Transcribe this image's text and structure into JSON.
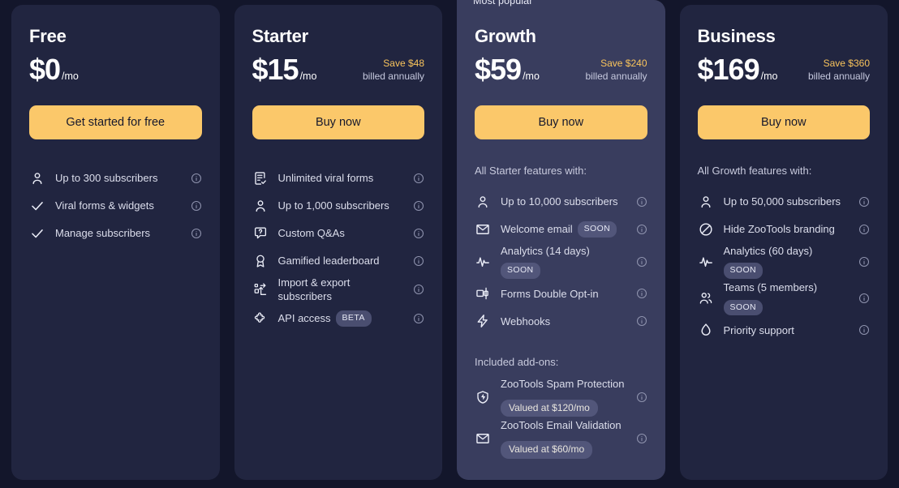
{
  "theme": {
    "page_bg": "#13162b",
    "card_bg": "#212540",
    "popular_card_bg": "#393d5e",
    "accent": "#fbc86a",
    "save_text": "#f9c45c"
  },
  "plans": [
    {
      "name": "Free",
      "price": "$0",
      "period": "/mo",
      "save_amount": "",
      "save_billed": "",
      "cta": "Get started for free",
      "features_intro": "",
      "features": [
        {
          "icon": "person-icon",
          "label": "Up to 300 subscribers",
          "tag": ""
        },
        {
          "icon": "check-icon",
          "label": "Viral forms & widgets",
          "tag": ""
        },
        {
          "icon": "check-icon",
          "label": "Manage subscribers",
          "tag": ""
        }
      ],
      "addons_intro": "",
      "addons": []
    },
    {
      "name": "Starter",
      "price": "$15",
      "period": "/mo",
      "save_amount": "Save $48",
      "save_billed": "billed annually",
      "cta": "Buy now",
      "features_intro": "",
      "features": [
        {
          "icon": "form-check-icon",
          "label": "Unlimited viral forms",
          "tag": ""
        },
        {
          "icon": "person-icon",
          "label": "Up to 1,000 subscribers",
          "tag": ""
        },
        {
          "icon": "question-bubble-icon",
          "label": "Custom Q&As",
          "tag": ""
        },
        {
          "icon": "award-ribbon-icon",
          "label": "Gamified leaderboard",
          "tag": ""
        },
        {
          "icon": "import-export-icon",
          "label": "Import & export subscribers",
          "tag": ""
        },
        {
          "icon": "puzzle-icon",
          "label": "API access",
          "tag": "BETA"
        }
      ],
      "addons_intro": "",
      "addons": []
    },
    {
      "name": "Growth",
      "badge": "Most popular",
      "price": "$59",
      "period": "/mo",
      "save_amount": "Save $240",
      "save_billed": "billed annually",
      "cta": "Buy now",
      "features_intro": "All Starter features with:",
      "features": [
        {
          "icon": "person-icon",
          "label": "Up to 10,000 subscribers",
          "tag": ""
        },
        {
          "icon": "envelope-icon",
          "label": "Welcome email",
          "tag": "SOON"
        },
        {
          "icon": "analytics-pulse-icon",
          "label": "Analytics (14 days)",
          "tag": "SOON"
        },
        {
          "icon": "double-optin-icon",
          "label": "Forms Double Opt-in",
          "tag": ""
        },
        {
          "icon": "lightning-icon",
          "label": "Webhooks",
          "tag": ""
        }
      ],
      "addons_intro": "Included add-ons:",
      "addons": [
        {
          "icon": "shield-bolt-icon",
          "label": "ZooTools Spam Protection",
          "tag": "Valued at $120/mo"
        },
        {
          "icon": "envelope-icon",
          "label": "ZooTools Email Validation",
          "tag": "Valued at $60/mo"
        }
      ]
    },
    {
      "name": "Business",
      "price": "$169",
      "period": "/mo",
      "save_amount": "Save $360",
      "save_billed": "billed annually",
      "cta": "Buy now",
      "features_intro": "All Growth features with:",
      "features": [
        {
          "icon": "person-icon",
          "label": "Up to 50,000 subscribers",
          "tag": ""
        },
        {
          "icon": "no-entry-icon",
          "label": "Hide ZooTools branding",
          "tag": ""
        },
        {
          "icon": "analytics-pulse-icon",
          "label": "Analytics (60 days)",
          "tag": "SOON"
        },
        {
          "icon": "people-group-icon",
          "label": "Teams (5 members)",
          "tag": "SOON"
        },
        {
          "icon": "flame-icon",
          "label": "Priority support",
          "tag": ""
        }
      ],
      "addons_intro": "",
      "addons": []
    }
  ],
  "info_icon_name": "info-icon"
}
